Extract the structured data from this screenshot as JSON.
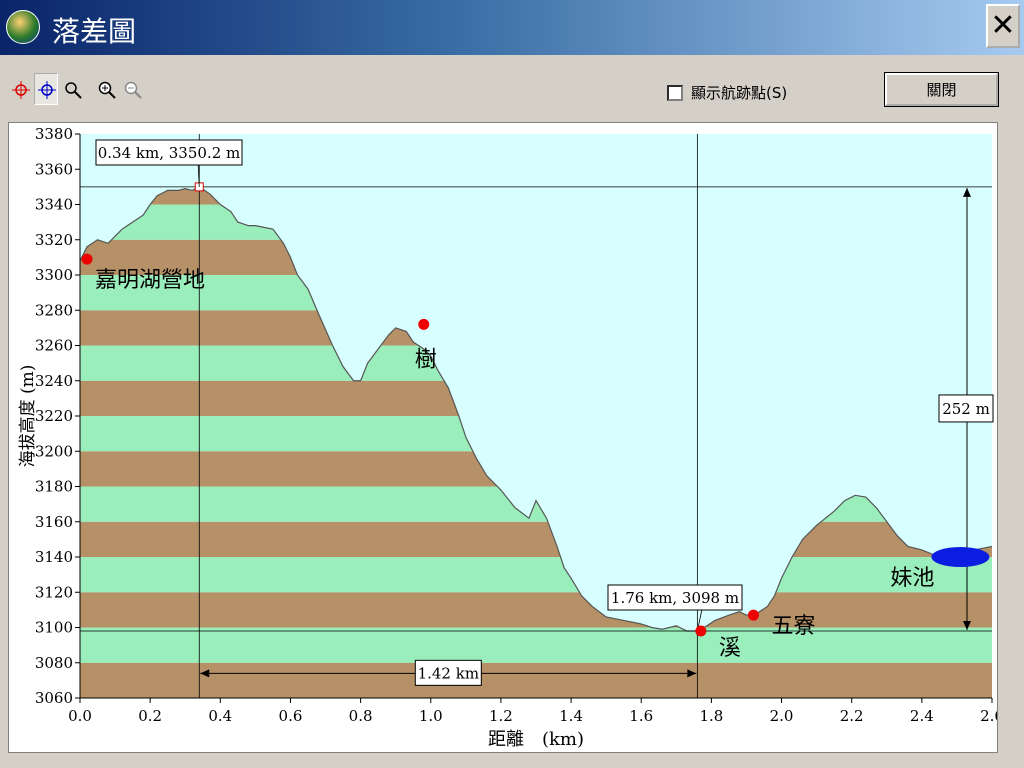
{
  "window": {
    "title": "落差圖",
    "close_glyph": "✕"
  },
  "toolbar": {
    "buttons": [
      "crosshair-red-icon",
      "crosshair-blue-icon",
      "magnifier-icon",
      "zoom-in-icon",
      "zoom-out-icon"
    ],
    "checkbox_label": "顯示航跡點(S)",
    "checkbox_checked": false,
    "close_label": "關閉"
  },
  "chart_data": {
    "type": "area",
    "xlabel": "距離　(km)",
    "ylabel": "海拔高度 (m)",
    "xlim": [
      0.0,
      2.6
    ],
    "ylim": [
      3060,
      3380
    ],
    "xticks": [
      "0.0",
      "0.2",
      "0.4",
      "0.6",
      "0.8",
      "1.0",
      "1.2",
      "1.4",
      "1.6",
      "1.8",
      "2.0",
      "2.2",
      "2.4",
      "2.6"
    ],
    "yticks": [
      "3060",
      "3080",
      "3100",
      "3120",
      "3140",
      "3160",
      "3180",
      "3200",
      "3220",
      "3240",
      "3260",
      "3280",
      "3300",
      "3320",
      "3340",
      "3360",
      "3380"
    ],
    "band_colors": [
      "#b69066",
      "#99eebb"
    ],
    "sky_color": "#d8ffff",
    "x": [
      0.0,
      0.02,
      0.05,
      0.08,
      0.12,
      0.15,
      0.18,
      0.2,
      0.22,
      0.25,
      0.28,
      0.3,
      0.32,
      0.34,
      0.37,
      0.4,
      0.43,
      0.45,
      0.48,
      0.5,
      0.55,
      0.58,
      0.6,
      0.62,
      0.65,
      0.68,
      0.72,
      0.75,
      0.78,
      0.8,
      0.82,
      0.85,
      0.88,
      0.9,
      0.93,
      0.95,
      0.98,
      1.0,
      1.02,
      1.05,
      1.08,
      1.1,
      1.13,
      1.16,
      1.2,
      1.24,
      1.28,
      1.3,
      1.33,
      1.36,
      1.38,
      1.4,
      1.43,
      1.46,
      1.5,
      1.55,
      1.6,
      1.63,
      1.66,
      1.7,
      1.73,
      1.76,
      1.78,
      1.81,
      1.85,
      1.88,
      1.9,
      1.93,
      1.96,
      1.98,
      2.0,
      2.03,
      2.06,
      2.1,
      2.15,
      2.18,
      2.21,
      2.24,
      2.27,
      2.3,
      2.33,
      2.36,
      2.4,
      2.45,
      2.5,
      2.55,
      2.6
    ],
    "y": [
      3308,
      3316,
      3320,
      3318,
      3326,
      3330,
      3334,
      3340,
      3345,
      3348,
      3348,
      3349,
      3348,
      3350,
      3346,
      3340,
      3336,
      3330,
      3328,
      3328,
      3326,
      3318,
      3310,
      3300,
      3292,
      3278,
      3260,
      3248,
      3240,
      3240,
      3250,
      3258,
      3266,
      3270,
      3268,
      3262,
      3258,
      3254,
      3246,
      3236,
      3220,
      3208,
      3196,
      3186,
      3178,
      3168,
      3162,
      3172,
      3162,
      3146,
      3134,
      3128,
      3118,
      3112,
      3106,
      3104,
      3102,
      3100,
      3099,
      3101,
      3098,
      3098,
      3100,
      3104,
      3107,
      3109,
      3107,
      3108,
      3112,
      3118,
      3128,
      3140,
      3150,
      3158,
      3166,
      3172,
      3175,
      3174,
      3168,
      3160,
      3152,
      3146,
      3144,
      3140,
      3140,
      3144,
      3146
    ],
    "waypoints": [
      {
        "x": 0.02,
        "y": 3309,
        "label": "嘉明湖營地"
      },
      {
        "x": 0.98,
        "y": 3272,
        "label": "樹"
      },
      {
        "x": 1.77,
        "y": 3098,
        "label": "溪"
      },
      {
        "x": 1.92,
        "y": 3107,
        "label": "五寮"
      }
    ],
    "lake": {
      "x": 2.51,
      "y": 3140,
      "label": "妹池"
    },
    "cursor_high": {
      "x": 0.34,
      "y": 3350,
      "label": "0.34 km, 3350.2 m"
    },
    "cursor_low": {
      "x": 1.76,
      "y": 3098,
      "label": "1.76 km, 3098 m"
    },
    "horizontal_distance_label": "1.42 km",
    "vertical_diff_label": "252 m"
  }
}
